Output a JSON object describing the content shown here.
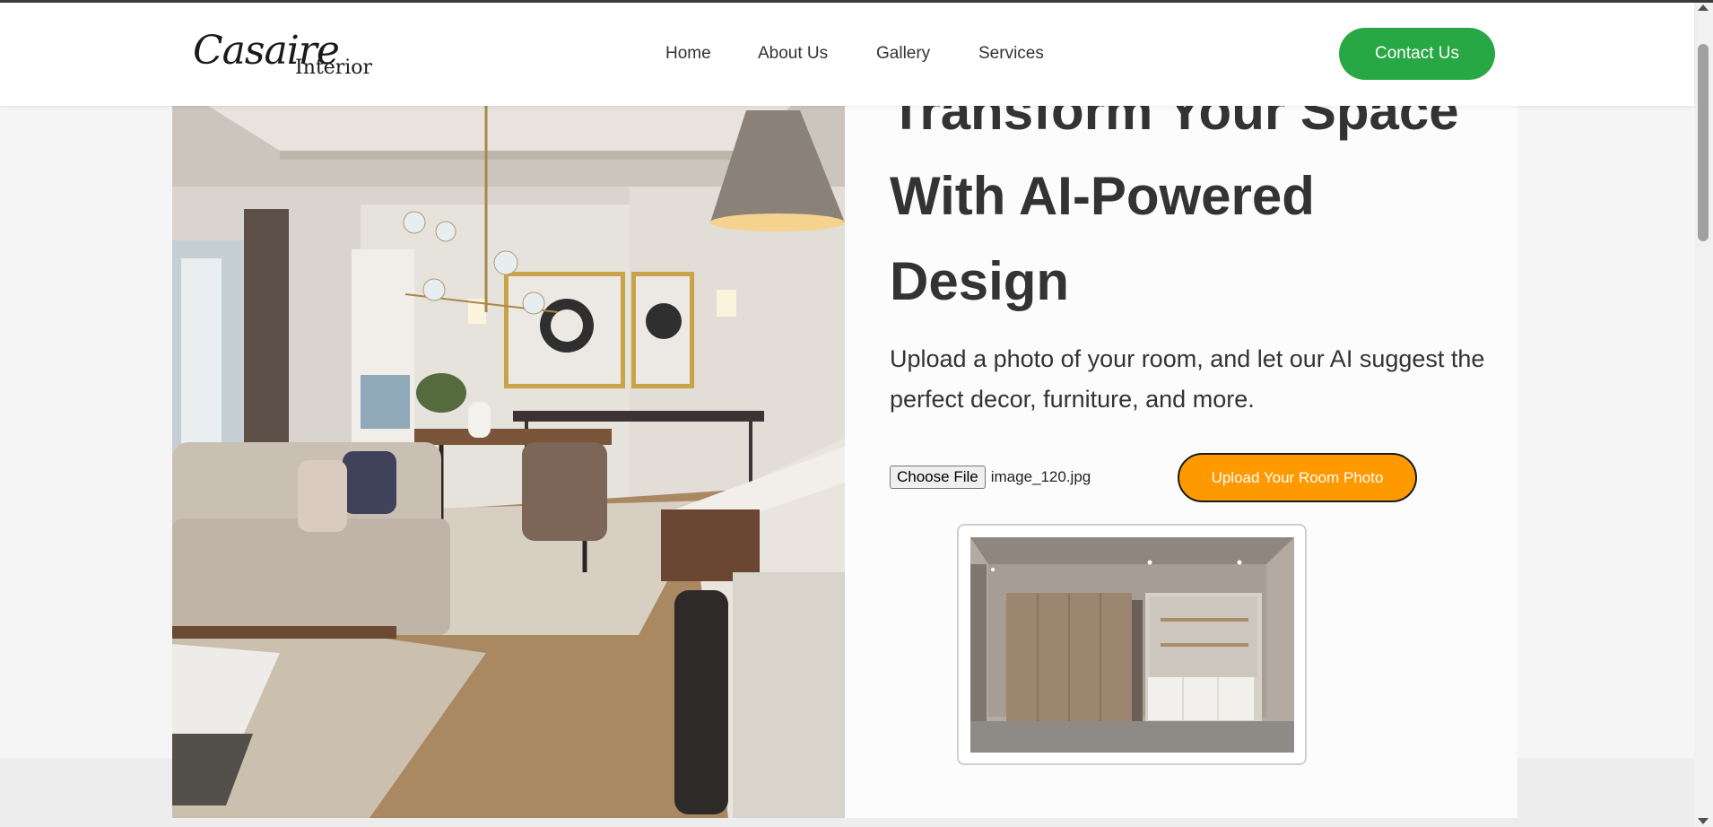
{
  "brand": {
    "logo_main": "Casaire",
    "logo_sub": "Interior"
  },
  "nav": {
    "items": [
      {
        "label": "Home"
      },
      {
        "label": "About Us"
      },
      {
        "label": "Gallery"
      },
      {
        "label": "Services"
      }
    ],
    "contact_label": "Contact Us"
  },
  "hero": {
    "headline_line1": "Transform Your Space",
    "headline_line2": "With AI-Powered",
    "headline_line3": "Design",
    "subtext": "Upload a photo of your room, and let our AI suggest the perfect decor, furniture, and more."
  },
  "upload": {
    "choose_label": "Choose File",
    "file_name": "image_120.jpg",
    "upload_label": "Upload Your Room Photo"
  },
  "colors": {
    "contact_green": "#28a745",
    "upload_orange": "#ff9900",
    "text_dark": "#333333"
  }
}
